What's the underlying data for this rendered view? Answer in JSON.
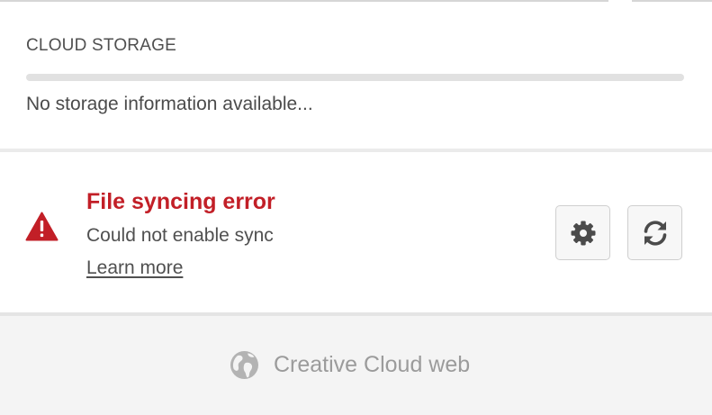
{
  "storage": {
    "heading": "CLOUD STORAGE",
    "usage_fraction": 0,
    "note": "No storage information available..."
  },
  "sync": {
    "title": "File syncing error",
    "message": "Could not enable sync",
    "link": "Learn more",
    "status_color": "#c21f27",
    "icons": {
      "status": "warning-icon",
      "settings": "gear-icon",
      "refresh": "sync-icon"
    }
  },
  "footer": {
    "link_label": "Creative Cloud web",
    "icon": "globe-icon"
  }
}
